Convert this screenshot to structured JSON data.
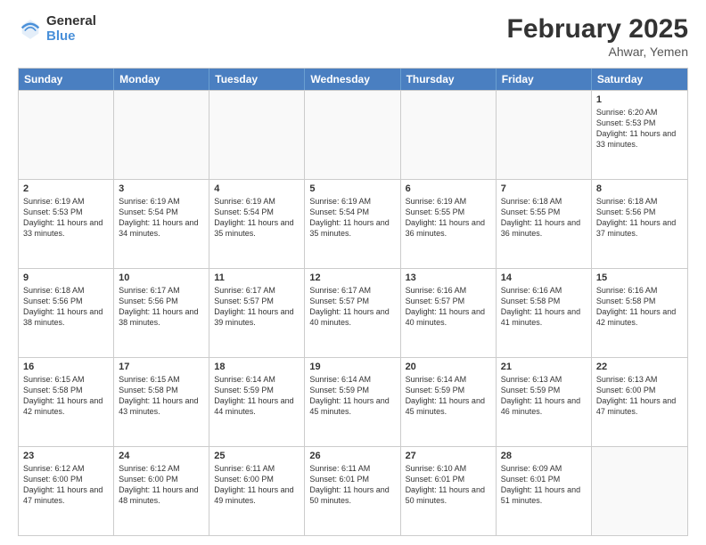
{
  "logo": {
    "general": "General",
    "blue": "Blue"
  },
  "header": {
    "title": "February 2025",
    "subtitle": "Ahwar, Yemen"
  },
  "weekdays": [
    "Sunday",
    "Monday",
    "Tuesday",
    "Wednesday",
    "Thursday",
    "Friday",
    "Saturday"
  ],
  "weeks": [
    [
      {
        "day": "",
        "info": "",
        "empty": true
      },
      {
        "day": "",
        "info": "",
        "empty": true
      },
      {
        "day": "",
        "info": "",
        "empty": true
      },
      {
        "day": "",
        "info": "",
        "empty": true
      },
      {
        "day": "",
        "info": "",
        "empty": true
      },
      {
        "day": "",
        "info": "",
        "empty": true
      },
      {
        "day": "1",
        "info": "Sunrise: 6:20 AM\nSunset: 5:53 PM\nDaylight: 11 hours and 33 minutes.",
        "empty": false
      }
    ],
    [
      {
        "day": "2",
        "info": "Sunrise: 6:19 AM\nSunset: 5:53 PM\nDaylight: 11 hours and 33 minutes.",
        "empty": false
      },
      {
        "day": "3",
        "info": "Sunrise: 6:19 AM\nSunset: 5:54 PM\nDaylight: 11 hours and 34 minutes.",
        "empty": false
      },
      {
        "day": "4",
        "info": "Sunrise: 6:19 AM\nSunset: 5:54 PM\nDaylight: 11 hours and 35 minutes.",
        "empty": false
      },
      {
        "day": "5",
        "info": "Sunrise: 6:19 AM\nSunset: 5:54 PM\nDaylight: 11 hours and 35 minutes.",
        "empty": false
      },
      {
        "day": "6",
        "info": "Sunrise: 6:19 AM\nSunset: 5:55 PM\nDaylight: 11 hours and 36 minutes.",
        "empty": false
      },
      {
        "day": "7",
        "info": "Sunrise: 6:18 AM\nSunset: 5:55 PM\nDaylight: 11 hours and 36 minutes.",
        "empty": false
      },
      {
        "day": "8",
        "info": "Sunrise: 6:18 AM\nSunset: 5:56 PM\nDaylight: 11 hours and 37 minutes.",
        "empty": false
      }
    ],
    [
      {
        "day": "9",
        "info": "Sunrise: 6:18 AM\nSunset: 5:56 PM\nDaylight: 11 hours and 38 minutes.",
        "empty": false
      },
      {
        "day": "10",
        "info": "Sunrise: 6:17 AM\nSunset: 5:56 PM\nDaylight: 11 hours and 38 minutes.",
        "empty": false
      },
      {
        "day": "11",
        "info": "Sunrise: 6:17 AM\nSunset: 5:57 PM\nDaylight: 11 hours and 39 minutes.",
        "empty": false
      },
      {
        "day": "12",
        "info": "Sunrise: 6:17 AM\nSunset: 5:57 PM\nDaylight: 11 hours and 40 minutes.",
        "empty": false
      },
      {
        "day": "13",
        "info": "Sunrise: 6:16 AM\nSunset: 5:57 PM\nDaylight: 11 hours and 40 minutes.",
        "empty": false
      },
      {
        "day": "14",
        "info": "Sunrise: 6:16 AM\nSunset: 5:58 PM\nDaylight: 11 hours and 41 minutes.",
        "empty": false
      },
      {
        "day": "15",
        "info": "Sunrise: 6:16 AM\nSunset: 5:58 PM\nDaylight: 11 hours and 42 minutes.",
        "empty": false
      }
    ],
    [
      {
        "day": "16",
        "info": "Sunrise: 6:15 AM\nSunset: 5:58 PM\nDaylight: 11 hours and 42 minutes.",
        "empty": false
      },
      {
        "day": "17",
        "info": "Sunrise: 6:15 AM\nSunset: 5:58 PM\nDaylight: 11 hours and 43 minutes.",
        "empty": false
      },
      {
        "day": "18",
        "info": "Sunrise: 6:14 AM\nSunset: 5:59 PM\nDaylight: 11 hours and 44 minutes.",
        "empty": false
      },
      {
        "day": "19",
        "info": "Sunrise: 6:14 AM\nSunset: 5:59 PM\nDaylight: 11 hours and 45 minutes.",
        "empty": false
      },
      {
        "day": "20",
        "info": "Sunrise: 6:14 AM\nSunset: 5:59 PM\nDaylight: 11 hours and 45 minutes.",
        "empty": false
      },
      {
        "day": "21",
        "info": "Sunrise: 6:13 AM\nSunset: 5:59 PM\nDaylight: 11 hours and 46 minutes.",
        "empty": false
      },
      {
        "day": "22",
        "info": "Sunrise: 6:13 AM\nSunset: 6:00 PM\nDaylight: 11 hours and 47 minutes.",
        "empty": false
      }
    ],
    [
      {
        "day": "23",
        "info": "Sunrise: 6:12 AM\nSunset: 6:00 PM\nDaylight: 11 hours and 47 minutes.",
        "empty": false
      },
      {
        "day": "24",
        "info": "Sunrise: 6:12 AM\nSunset: 6:00 PM\nDaylight: 11 hours and 48 minutes.",
        "empty": false
      },
      {
        "day": "25",
        "info": "Sunrise: 6:11 AM\nSunset: 6:00 PM\nDaylight: 11 hours and 49 minutes.",
        "empty": false
      },
      {
        "day": "26",
        "info": "Sunrise: 6:11 AM\nSunset: 6:01 PM\nDaylight: 11 hours and 50 minutes.",
        "empty": false
      },
      {
        "day": "27",
        "info": "Sunrise: 6:10 AM\nSunset: 6:01 PM\nDaylight: 11 hours and 50 minutes.",
        "empty": false
      },
      {
        "day": "28",
        "info": "Sunrise: 6:09 AM\nSunset: 6:01 PM\nDaylight: 11 hours and 51 minutes.",
        "empty": false
      },
      {
        "day": "",
        "info": "",
        "empty": true
      }
    ]
  ]
}
